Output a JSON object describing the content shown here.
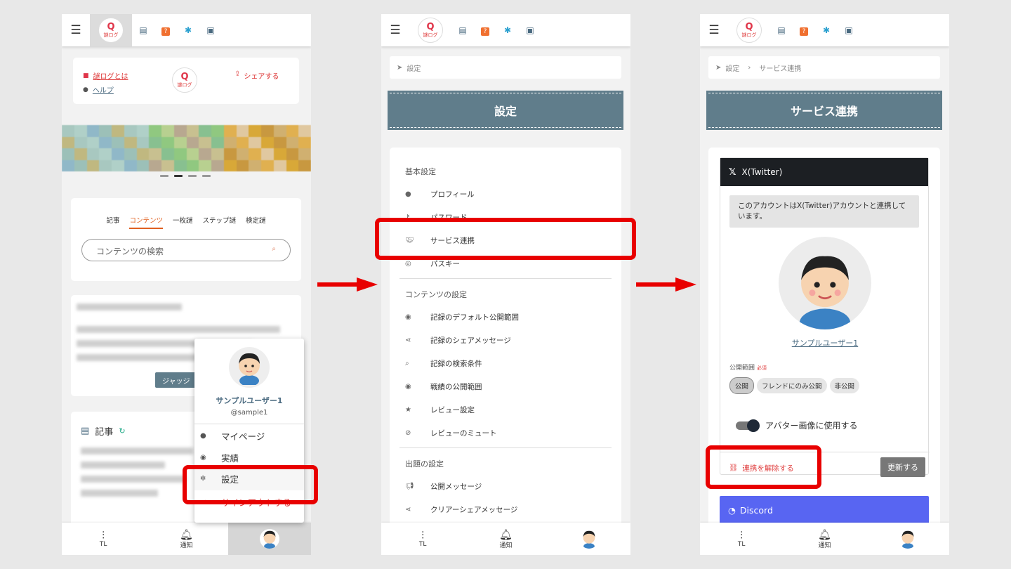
{
  "header": {
    "logo_text": "謎ログ",
    "logo_mark": "Q"
  },
  "bottom_nav": {
    "tl": "TL",
    "notify": "通知"
  },
  "panel1": {
    "about": "謎ログとは",
    "help": "ヘルプ",
    "share": "シェアする",
    "tabs": [
      "記事",
      "コンテンツ",
      "一枚謎",
      "ステップ謎",
      "検定謎"
    ],
    "search_placeholder": "コンテンツの検索",
    "judge_button": "ジャッジ",
    "articles_title": "記事",
    "menu": {
      "username": "サンプルユーザー1",
      "handle": "@sample1",
      "items": [
        "マイページ",
        "実績",
        "設定",
        "サインアウトする"
      ]
    }
  },
  "panel2": {
    "breadcrumb": "設定",
    "banner": "設定",
    "sections": [
      {
        "title": "基本設定",
        "items": [
          "プロフィール",
          "パスワード",
          "サービス連携",
          "パスキー"
        ]
      },
      {
        "title": "コンテンツの設定",
        "items": [
          "記録のデフォルト公開範囲",
          "記録のシェアメッセージ",
          "記録の検索条件",
          "戦績の公開範囲",
          "レビュー設定",
          "レビューのミュート"
        ]
      },
      {
        "title": "出題の設定",
        "items": [
          "公開メッセージ",
          "クリアーシェアメッセージ"
        ]
      }
    ]
  },
  "panel3": {
    "breadcrumb": [
      "設定",
      "サービス連携"
    ],
    "banner": "サービス連携",
    "twitter": {
      "title": "X(Twitter)",
      "notice": "このアカウントはX(Twitter)アカウントと連携しています。",
      "username": "サンプルユーザー1",
      "visibility_label": "公開範囲",
      "required": "必須",
      "options": [
        "公開",
        "フレンドにのみ公開",
        "非公開"
      ],
      "avatar_toggle": "アバター画像に使用する",
      "unlink": "連携を解除する",
      "update": "更新する"
    },
    "discord": {
      "title": "Discord"
    }
  },
  "colors": {
    "accent": "#e06020",
    "banner": "#607d8b",
    "highlight": "#e80000",
    "discord": "#5865f2"
  }
}
